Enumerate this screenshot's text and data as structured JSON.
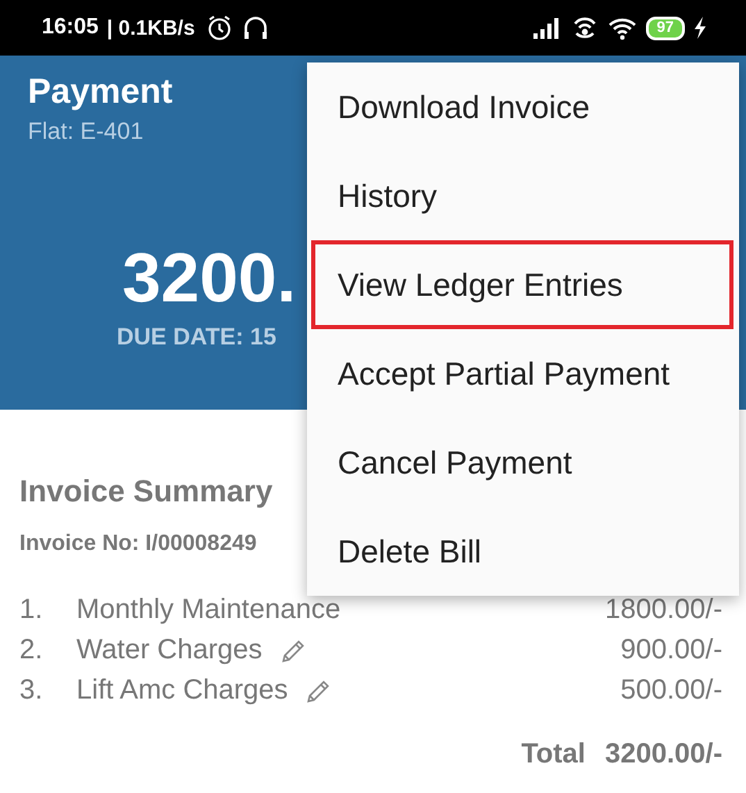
{
  "status_bar": {
    "time": "16:05",
    "speed": "| 0.1KB/s",
    "battery": "97"
  },
  "header": {
    "title": "Payment",
    "subtitle": "Flat: E-401",
    "amount": "3200.",
    "due_date": "DUE DATE: 15"
  },
  "invoice": {
    "title": "Invoice Summary",
    "number": "Invoice No: I/00008249",
    "items": [
      {
        "index": "1.",
        "name": "Monthly Maintenance",
        "amount": "1800.00/-",
        "editable": false
      },
      {
        "index": "2.",
        "name": "Water Charges",
        "amount": "900.00/-",
        "editable": true
      },
      {
        "index": "3.",
        "name": "Lift Amc Charges",
        "amount": "500.00/-",
        "editable": true
      }
    ],
    "total_label": "Total",
    "total": "3200.00/-"
  },
  "menu": [
    {
      "label": "Download Invoice",
      "highlighted": false
    },
    {
      "label": "History",
      "highlighted": false
    },
    {
      "label": "View Ledger Entries",
      "highlighted": true
    },
    {
      "label": "Accept Partial Payment",
      "highlighted": false
    },
    {
      "label": "Cancel Payment",
      "highlighted": false
    },
    {
      "label": "Delete Bill",
      "highlighted": false
    }
  ]
}
